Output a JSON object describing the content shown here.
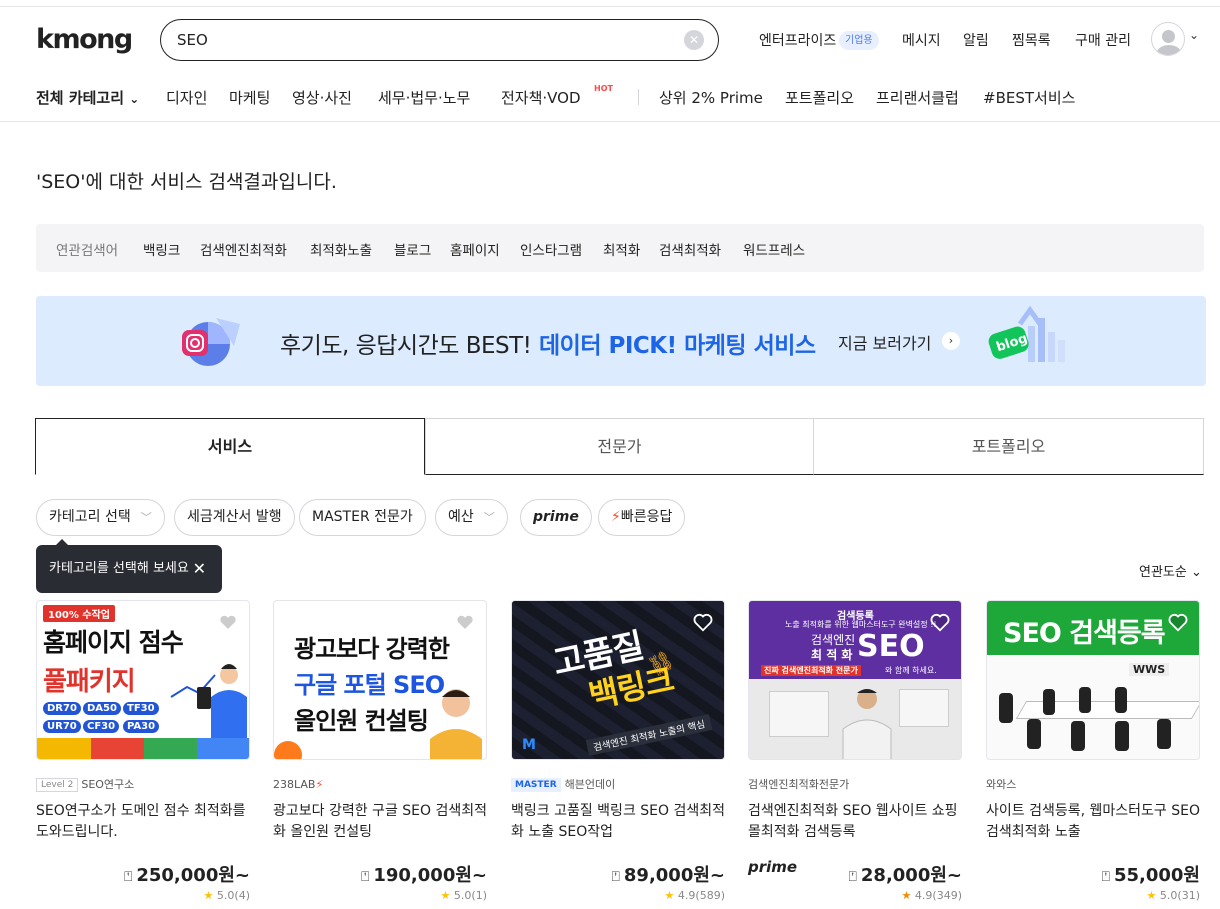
{
  "header": {
    "logo": "kmong",
    "search_value": "SEO",
    "nav": [
      "엔터프라이즈",
      "메시지",
      "알림",
      "찜목록",
      "구매 관리"
    ],
    "biz_badge": "기업용"
  },
  "category_nav": {
    "all": "전체 카테고리",
    "items": [
      "디자인",
      "마케팅",
      "영상·사진",
      "세무·법무·노무",
      "전자책·VOD"
    ],
    "hot_badge": "HOT",
    "extra": [
      "상위 2% Prime",
      "포트폴리오",
      "프리랜서클럽",
      "#BEST서비스"
    ]
  },
  "result_title": "'SEO'에 대한 서비스 검색결과입니다.",
  "related": {
    "label": "연관검색어",
    "items": [
      "백링크",
      "검색엔진최적화",
      "최적화노출",
      "블로그",
      "홈페이지",
      "인스타그램",
      "최적화",
      "검색최적화",
      "워드프레스"
    ]
  },
  "banner": {
    "text": "후기도, 응답시간도 BEST!",
    "highlight": "데이터 PICK! 마케팅 서비스",
    "cta": "지금 보러가기"
  },
  "tabs": [
    "서비스",
    "전문가",
    "포트폴리오"
  ],
  "filters": {
    "category": "카테고리 선택",
    "tax": "세금계산서 발행",
    "master": "MASTER 전문가",
    "budget": "예산",
    "prime": "prime",
    "fast": "빠른응답"
  },
  "tooltip": "카테고리를 선택해 보세요",
  "sort": "연관도순",
  "cards": [
    {
      "thumb": {
        "badge": "100% 수작업",
        "line1": "홈페이지 점수",
        "line2": "풀패키지",
        "tags": [
          "DR70",
          "DA50",
          "TF30",
          "UR70",
          "CF30",
          "PA30"
        ]
      },
      "level": "Level 2",
      "seller": "SEO연구소",
      "title": "SEO연구소가 도메인 점수 최적화를 도와드립니다.",
      "price": "250,000원~",
      "rating": "5.0",
      "reviews": "(4)"
    },
    {
      "thumb": {
        "line1": "광고보다 강력한",
        "line2": "구글 포털 SEO",
        "line3": "올인원 컨설팅"
      },
      "seller": "238LAB",
      "title": "광고보다 강력한 구글 SEO 검색최적화 올인원 컨설팅",
      "price": "190,000원~",
      "rating": "5.0",
      "reviews": "(1)"
    },
    {
      "thumb": {
        "line1": "고품질",
        "line2": "백링크",
        "caption": "검색엔진 최적화 노출의 핵심"
      },
      "master": "MASTER",
      "seller": "해븐언데이",
      "title": "백링크 고품질 백링크 SEO 검색최적화 노출 SEO작업",
      "price": "89,000원~",
      "rating": "4.9",
      "reviews": "(589)"
    },
    {
      "thumb": {
        "top": "검색등록",
        "sub": "노출 최적화를 위한 웹마스터도구 완벽설정 !!",
        "line1": "검색엔진",
        "line2": "최 적 화",
        "seo": "SEO",
        "tag": "진짜 검색엔진최적화 전문가",
        "tail": "와 함께 하세요."
      },
      "seller": "검색엔진최적화전문가",
      "title": "검색엔진최적화 SEO 웹사이트 쇼핑몰최적화 검색등록",
      "prime": "prime",
      "price": "28,000원~",
      "rating": "4.9",
      "reviews": "(349)"
    },
    {
      "thumb": {
        "line1": "SEO 검색등록",
        "sign": "WWS"
      },
      "seller": "와와스",
      "title": "사이트 검색등록, 웹마스터도구 SEO 검색최적화 노출",
      "price": "55,000원",
      "rating": "5.0",
      "reviews": "(31)"
    }
  ]
}
